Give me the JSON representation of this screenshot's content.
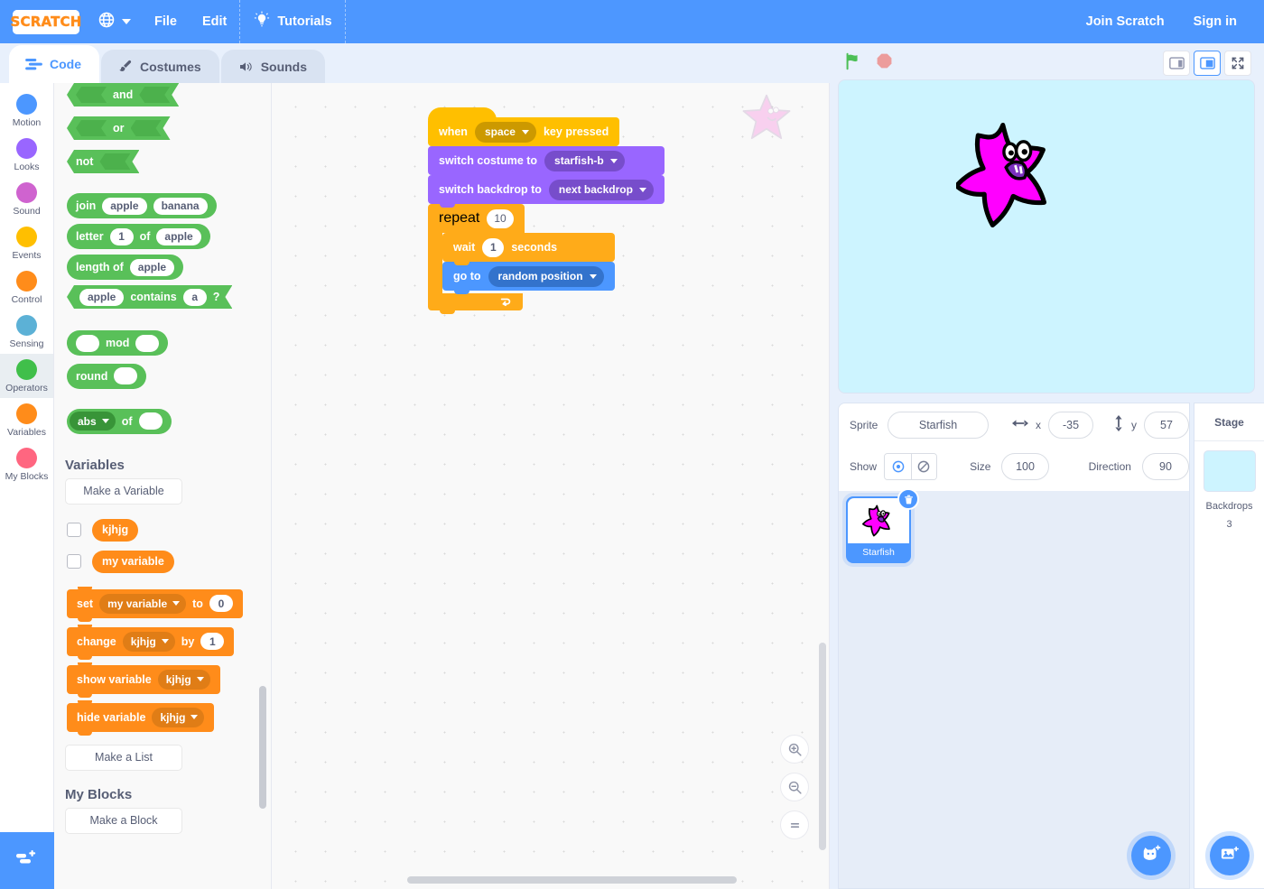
{
  "menubar": {
    "logo_text": "SCRATCH",
    "globe_icon": "globe-icon",
    "file_label": "File",
    "edit_label": "Edit",
    "tutorials_label": "Tutorials",
    "tutorials_icon": "lightbulb-icon",
    "join_label": "Join Scratch",
    "signin_label": "Sign in",
    "accent_color": "#4d97ff"
  },
  "tabs": [
    {
      "label": "Code",
      "icon": "code-icon",
      "active": true
    },
    {
      "label": "Costumes",
      "icon": "paintbrush-icon",
      "active": false
    },
    {
      "label": "Sounds",
      "icon": "speaker-icon",
      "active": false
    }
  ],
  "stage_controls": {
    "green_flag_icon": "green-flag-icon",
    "stop_icon": "stop-sign-icon",
    "small_stage_icon": "small-stage-layout-icon",
    "large_stage_icon": "large-stage-layout-icon",
    "fullscreen_icon": "fullscreen-icon"
  },
  "categories": [
    {
      "label": "Motion",
      "color": "#4c97ff",
      "selected": false
    },
    {
      "label": "Looks",
      "color": "#9966ff",
      "selected": false
    },
    {
      "label": "Sound",
      "color": "#cf63cf",
      "selected": false
    },
    {
      "label": "Events",
      "color": "#ffbf00",
      "selected": false
    },
    {
      "label": "Control",
      "color": "#ff8c1a",
      "selected": false
    },
    {
      "label": "Sensing",
      "color": "#5cb1d6",
      "selected": false
    },
    {
      "label": "Operators",
      "color": "#40bf4a",
      "selected": true
    },
    {
      "label": "Variables",
      "color": "#ff8c1a",
      "selected": false
    },
    {
      "label": "My Blocks",
      "color": "#ff6680",
      "selected": false
    }
  ],
  "add_extension": {
    "icon": "add-extension-icon",
    "label": "Add Extension"
  },
  "palette": {
    "operators": {
      "and_label": "and",
      "or_label": "or",
      "not_label": "not",
      "join_label": "join",
      "join_a": "apple",
      "join_b": "banana",
      "letter_label": "letter",
      "letter_index": "1",
      "letter_of": "of",
      "letter_word": "apple",
      "lengthof_label": "length of",
      "lengthof_word": "apple",
      "contains_word": "apple",
      "contains_label": "contains",
      "contains_char": "a",
      "contains_q": "?",
      "mod_label": "mod",
      "round_label": "round",
      "abs_label": "abs",
      "abs_of": "of"
    },
    "variables_section": {
      "title": "Variables",
      "make_variable": "Make a Variable",
      "var1": "kjhjg",
      "var2": "my variable",
      "set_label": "set",
      "set_var": "my variable",
      "set_to": "to",
      "set_value": "0",
      "change_label": "change",
      "change_var": "kjhjg",
      "change_by": "by",
      "change_value": "1",
      "show_variable": "show variable",
      "show_var": "kjhjg",
      "hide_variable": "hide variable",
      "hide_var": "kjhjg",
      "make_list": "Make a List"
    },
    "myblocks_section": {
      "title": "My Blocks",
      "make_block": "Make a Block"
    }
  },
  "script": {
    "hat_when": "when",
    "hat_key": "space",
    "hat_keypressed": "key pressed",
    "switch_costume": "switch costume to",
    "costume_value": "starfish-b",
    "switch_backdrop": "switch backdrop to",
    "backdrop_value": "next backdrop",
    "repeat_label": "repeat",
    "repeat_value": "10",
    "wait_label": "wait",
    "wait_value": "1",
    "wait_seconds": "seconds",
    "goto_label": "go to",
    "goto_value": "random position"
  },
  "workspace": {
    "zoom_in_icon": "zoom-in-icon",
    "zoom_out_icon": "zoom-out-icon",
    "zoom_reset_icon": "zoom-reset-icon"
  },
  "sprite_info": {
    "sprite_label": "Sprite",
    "sprite_name": "Starfish",
    "x_label": "x",
    "x_value": "-35",
    "y_label": "y",
    "y_value": "57",
    "show_label": "Show",
    "show_icon": "eye-visible-icon",
    "hide_icon": "eye-hidden-icon",
    "size_label": "Size",
    "size_value": "100",
    "direction_label": "Direction",
    "direction_value": "90"
  },
  "sprites": [
    {
      "name": "Starfish",
      "selected": true,
      "delete_icon": "trash-icon"
    }
  ],
  "sprite_fab": {
    "icon": "choose-sprite-icon"
  },
  "stage_panel": {
    "title": "Stage",
    "backdrops_label": "Backdrops",
    "backdrops_count": "3",
    "fab_icon": "choose-backdrop-icon"
  },
  "colors": {
    "motion": "#4c97ff",
    "looks": "#9966ff",
    "control": "#ffab19",
    "events": "#ffbf00",
    "operators": "#59c059",
    "variables": "#ff8c1a",
    "stage_bg": "#cdf4ff",
    "sprite_pink": "#ff00ff"
  }
}
